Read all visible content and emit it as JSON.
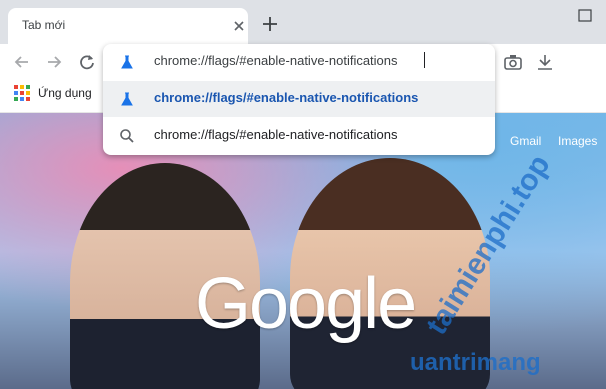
{
  "tab": {
    "title": "Tab mới"
  },
  "bookmarks": {
    "apps_label": "Ứng dụng"
  },
  "omnibox": {
    "input_value": "chrome://flags/#enable-native-notifications",
    "suggestions": [
      {
        "text": "chrome://flags/#enable-native-notifications",
        "icon": "flask-icon"
      },
      {
        "text": "chrome://flags/#enable-native-notifications",
        "icon": "search-icon"
      }
    ]
  },
  "ntp": {
    "links": [
      "Gmail",
      "Images"
    ],
    "logo": "Google"
  },
  "watermark": {
    "top": "taimienphi.top",
    "bottom": "uantrimang"
  },
  "colors": {
    "accent_blue": "#1a73e8",
    "tabstrip": "#dee1e6"
  }
}
